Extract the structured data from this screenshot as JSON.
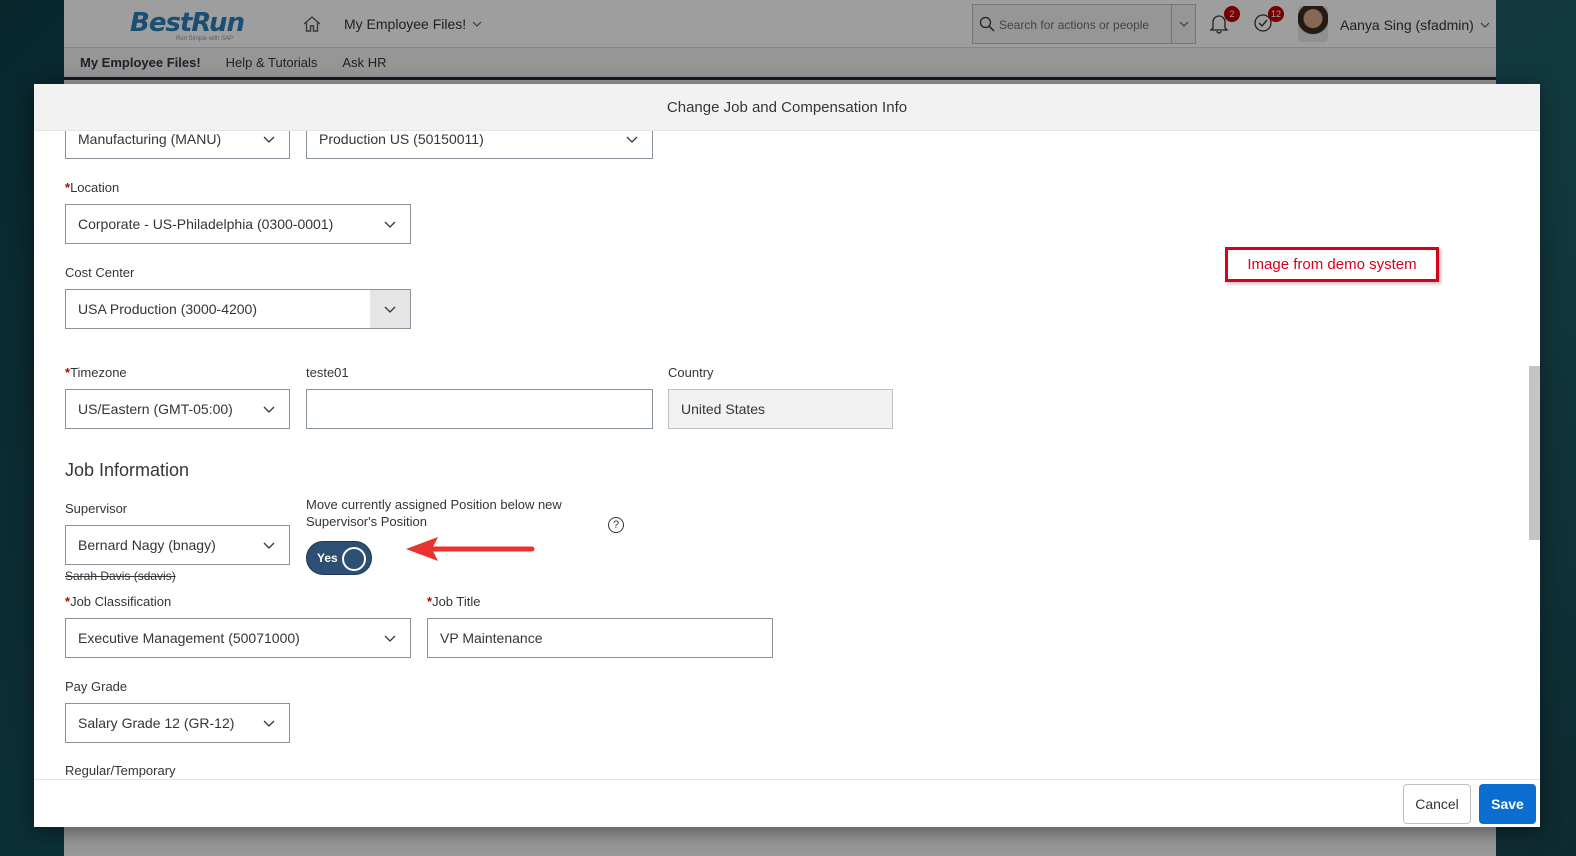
{
  "app": {
    "logo": "BestRun",
    "logo_tagline": "Run Simple with SAP",
    "app_menu_label": "My Employee Files!",
    "search_placeholder": "Search for actions or people",
    "notifications_count": "2",
    "todo_count": "12",
    "user_name": "Aanya Sing (sfadmin)",
    "sub_nav": {
      "item1": "My Employee Files!",
      "item2": "Help & Tutorials",
      "item3": "Ask HR"
    }
  },
  "modal": {
    "title": "Change Job and Compensation Info",
    "cancel_label": "Cancel",
    "save_label": "Save"
  },
  "form": {
    "division_value": "Manufacturing (MANU)",
    "department_value": "Production US (50150011)",
    "location_label": "Location",
    "location_value": "Corporate - US-Philadelphia (0300-0001)",
    "cost_center_label": "Cost Center",
    "cost_center_value": "USA Production (3000-4200)",
    "timezone_label": "Timezone",
    "timezone_value": "US/Eastern (GMT-05:00)",
    "teste01_label": "teste01",
    "teste01_value": "",
    "country_label": "Country",
    "country_value": "United States",
    "job_info_title": "Job Information",
    "supervisor_label": "Supervisor",
    "supervisor_value": "Bernard Nagy (bnagy)",
    "supervisor_previous": "Sarah Davis (sdavis)",
    "move_position_label_line1": "Move currently assigned Position below new",
    "move_position_label_line2": "Supervisor's Position",
    "move_position_toggle": "Yes",
    "job_classification_label": "Job Classification",
    "job_classification_value": "Executive Management (50071000)",
    "job_title_label": "Job Title",
    "job_title_value": "VP Maintenance",
    "pay_grade_label": "Pay Grade",
    "pay_grade_value": "Salary Grade 12 (GR-12)",
    "regular_temporary_label": "Regular/Temporary",
    "required_mark": "*",
    "help_glyph": "?"
  },
  "annotation": {
    "note": "Image from demo system"
  },
  "colors": {
    "brand_blue": "#0a6ed1",
    "required_red": "#bb0000",
    "toggle_on": "#2d4f73",
    "annotation_red": "#d9001b"
  }
}
